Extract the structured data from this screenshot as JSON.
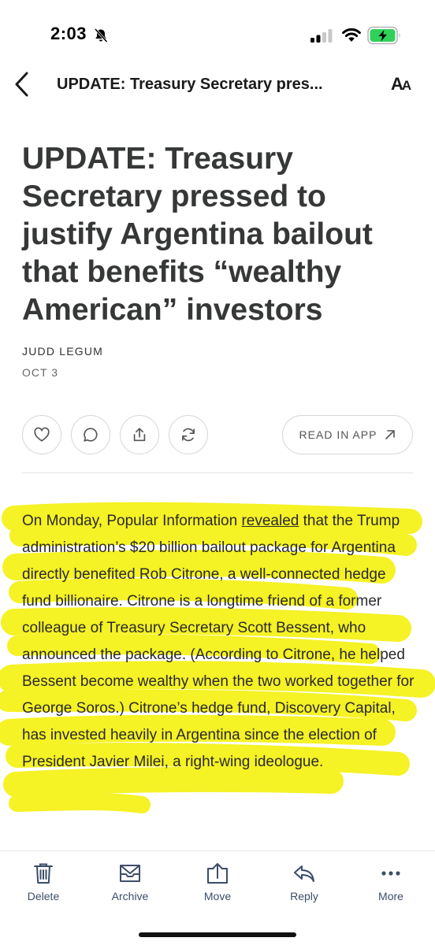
{
  "status_bar": {
    "time": "2:03",
    "battery_color": "#30d158"
  },
  "nav": {
    "title": "UPDATE: Treasury Secretary pres...",
    "text_size_label_big": "A",
    "text_size_label_small": "A"
  },
  "article": {
    "title": "UPDATE: Treasury Secretary pressed to justify Argentina bailout that benefits “wealthy American” investors",
    "author": "JUDD LEGUM",
    "date": "OCT 3",
    "read_in_app_label": "READ IN APP",
    "body_before_link": "On Monday, Popular Information ",
    "body_link": "revealed",
    "body_after_link": " that the Trump administration’s $20 billion bailout package for Argentina directly benefited Rob Citrone, a well-connected hedge fund billionaire. Citrone is a longtime friend of a former colleague of Treasury Secretary Scott Bessent, who announced the package. (According to Citrone, he helped Bessent become wealthy when the two worked together for George Soros.) Citrone’s hedge fund, Discovery Capital, has invested heavily in Argentina since the election of President Javier Milei, a right-wing ideologue.",
    "highlight_color": "#f4f000"
  },
  "toolbar": {
    "items": [
      {
        "label": "Delete",
        "icon": "trash-icon"
      },
      {
        "label": "Archive",
        "icon": "archive-box-icon"
      },
      {
        "label": "Move",
        "icon": "move-to-folder-icon"
      },
      {
        "label": "Reply",
        "icon": "reply-arrow-icon"
      },
      {
        "label": "More",
        "icon": "ellipsis-icon"
      }
    ],
    "label_color": "#3c4d6a"
  }
}
